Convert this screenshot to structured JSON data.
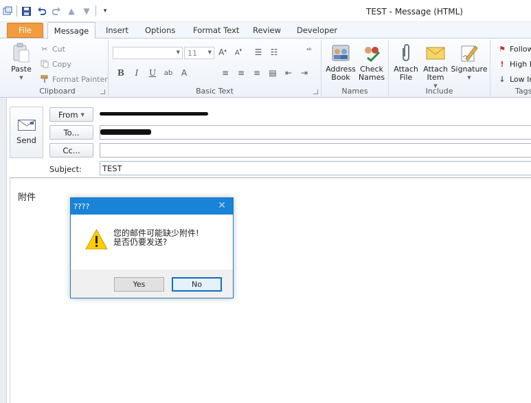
{
  "window": {
    "title": "TEST  -  Message (HTML)"
  },
  "quick_access": {
    "icons": [
      "app-icon",
      "save-icon",
      "undo-icon",
      "redo-icon",
      "up-arrow-icon",
      "down-arrow-icon",
      "customize-icon"
    ]
  },
  "tabs": {
    "file": "File",
    "items": [
      "Message",
      "Insert",
      "Options",
      "Format Text",
      "Review",
      "Developer"
    ]
  },
  "ribbon": {
    "clipboard": {
      "label": "Clipboard",
      "paste": "Paste",
      "cut": "Cut",
      "copy": "Copy",
      "format_painter": "Format Painter"
    },
    "basic_text": {
      "label": "Basic Text",
      "font_size": "11"
    },
    "names": {
      "label": "Names",
      "address_book": "Address Book",
      "check_names": "Check Names"
    },
    "include": {
      "label": "Include",
      "attach_file": "Attach File",
      "attach_item": "Attach Item",
      "signature": "Signature"
    },
    "tags": {
      "label": "Tags",
      "follow_up": "Follow",
      "high": "High I",
      "low": "Low In"
    }
  },
  "compose": {
    "send": "Send",
    "from": "From",
    "to": "To...",
    "cc": "Cc...",
    "subject_label": "Subject:",
    "subject_value": "TEST",
    "body": "附件"
  },
  "dialog": {
    "title": "????",
    "line1": "您的邮件可能缺少附件!",
    "line2": "是否仍要发送?",
    "yes": "Yes",
    "no": "No"
  },
  "colors": {
    "file_tab": "#f29b3f",
    "dialog_title": "#1883d7",
    "warning": "#ffcc00"
  }
}
